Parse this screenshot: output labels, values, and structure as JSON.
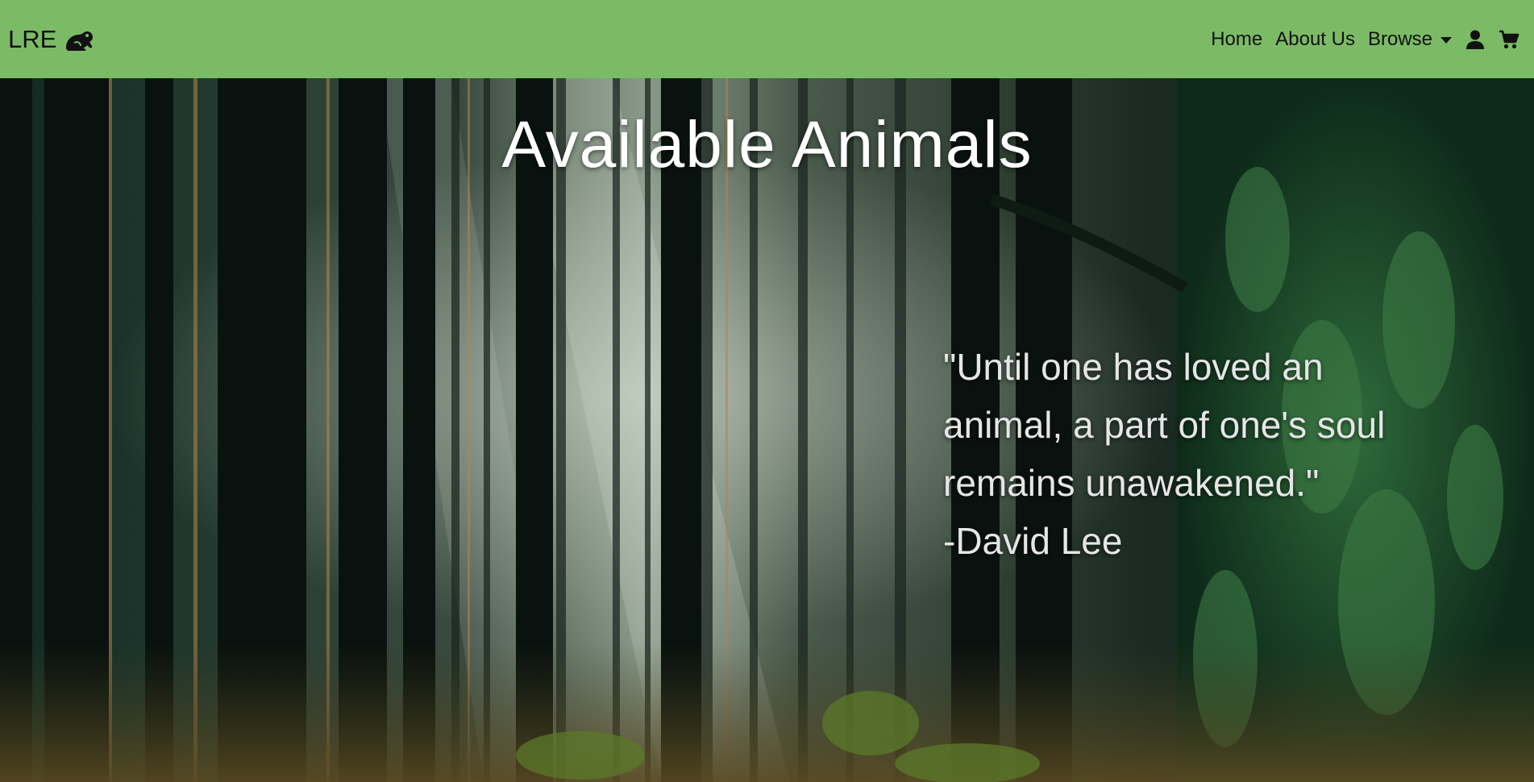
{
  "navbar": {
    "brand_label": "LRE",
    "brand_icon": "frog-icon",
    "links": [
      {
        "label": "Home"
      },
      {
        "label": "About Us"
      },
      {
        "label": "Browse"
      }
    ],
    "user_icon": "user-icon",
    "cart_icon": "cart-icon",
    "bg_color": "#7cbb66"
  },
  "hero": {
    "title": "Available Animals",
    "background": "forest-image",
    "quote": {
      "text": "\"Until one has loved an animal, a part of one's soul remains unawakened.\"",
      "author": "-David Lee"
    }
  }
}
